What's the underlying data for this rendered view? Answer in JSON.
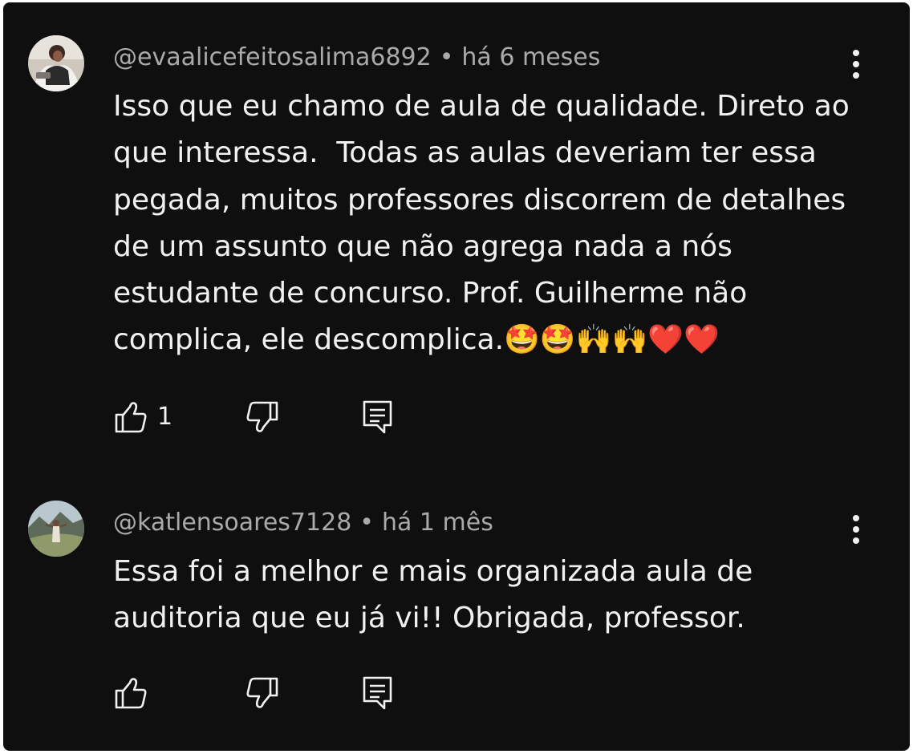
{
  "comments": [
    {
      "handle": "@evaalicefeitosalima6892",
      "separator": "•",
      "time": "há 6 meses",
      "text": "Isso que eu chamo de aula de qualidade. Direto ao que interessa.  Todas as aulas deveriam ter essa pegada, muitos professores discorrem de detalhes de um assunto que não agrega nada a nós estudante de concurso. Prof. Guilherme não complica, ele descomplica.🤩🤩🙌🙌❤️❤️",
      "like_count": "1",
      "avatar_icon": "avatar-photo-person-seated"
    },
    {
      "handle": "@katlensoares7128",
      "separator": "•",
      "time": "há 1 mês",
      "text": "Essa foi a melhor e mais organizada aula de auditoria que eu já vi!! Obrigada, professor.",
      "like_count": "",
      "avatar_icon": "avatar-photo-person-mountains"
    }
  ],
  "icons": {
    "like": "thumbs-up-icon",
    "dislike": "thumbs-down-icon",
    "reply": "reply-comment-icon",
    "more": "more-vertical-icon"
  },
  "colors": {
    "background": "#0f0f0f",
    "text": "#f1f1f1",
    "meta": "#aaaaaa"
  }
}
